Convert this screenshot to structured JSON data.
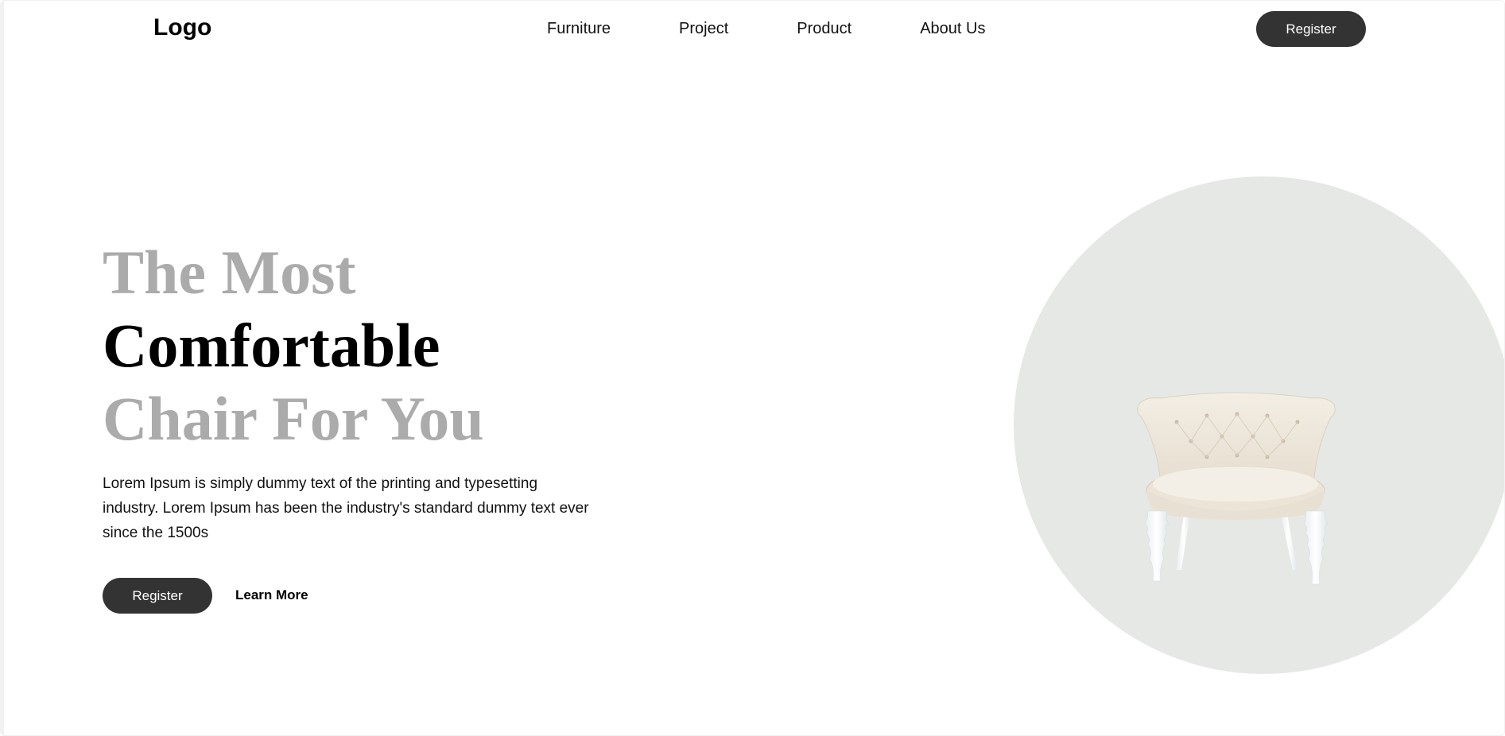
{
  "header": {
    "logo": "Logo",
    "nav": [
      "Furniture",
      "Project",
      "Product",
      "About Us"
    ],
    "register_label": "Register"
  },
  "hero": {
    "headline_line1": "The Most",
    "headline_line2": "Comfortable",
    "headline_line3": "Chair For You",
    "description": "Lorem Ipsum is simply dummy text of the printing and typesetting industry. Lorem Ipsum has been the industry's standard dummy text ever since the 1500s",
    "register_label": "Register",
    "learn_more_label": "Learn More"
  },
  "image": {
    "icon": "armchair-illustration"
  },
  "colors": {
    "dark_button": "#333333",
    "headline_grey": "#ababab",
    "headline_black": "#000000",
    "circle_bg": "#e5e8e5",
    "chair_fabric": "#efe9de",
    "chair_legs": "#f4f6f7"
  }
}
